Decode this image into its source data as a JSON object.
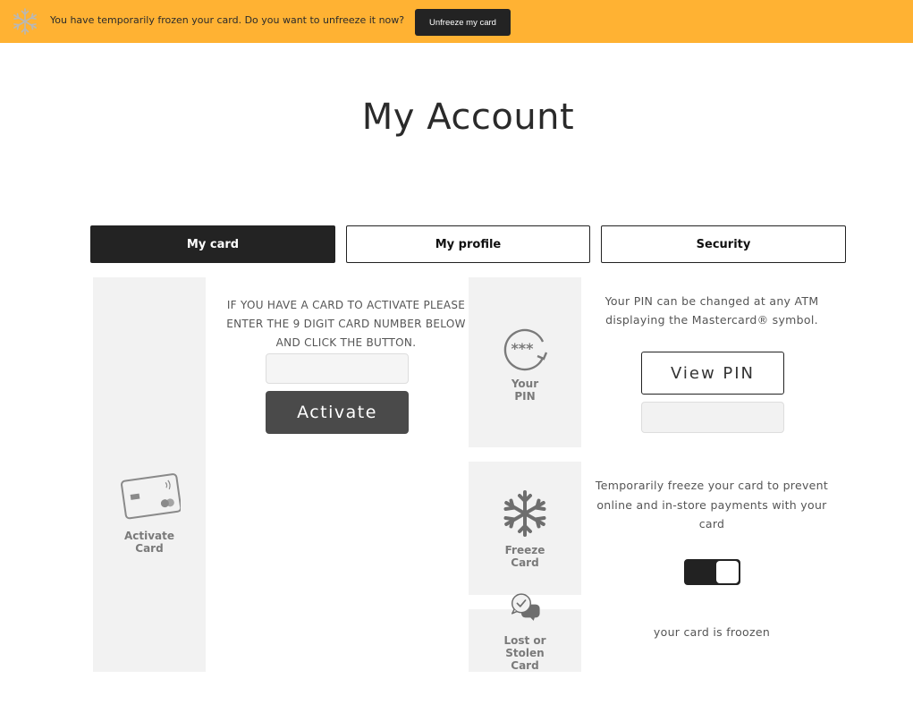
{
  "banner": {
    "icon": "snowflake-icon",
    "message": "You have temporarily frozen your card. Do you want to unfreeze it now?",
    "button_label": "Unfreeze my card",
    "background_color": "#ffb233"
  },
  "page": {
    "title": "My Account"
  },
  "tabs": [
    {
      "label": "My card",
      "active": true
    },
    {
      "label": "My profile",
      "active": false
    },
    {
      "label": "Security",
      "active": false
    }
  ],
  "activate": {
    "tile_icon": "credit-card-icon",
    "tile_label": "Activate\nCard",
    "instructions": "IF YOU HAVE A CARD TO ACTIVATE PLEASE ENTER THE 9 DIGIT CARD NUMBER BELOW AND CLICK THE BUTTON.",
    "input_value": "",
    "button_label": "Activate"
  },
  "pin": {
    "tile_icon": "pin-refresh-icon",
    "tile_label": "Your\nPIN",
    "description": "Your PIN can be changed at any ATM displaying the Mastercard® symbol.",
    "button_label": "View PIN",
    "display_value": ""
  },
  "freeze": {
    "tile_icon": "snowflake-icon",
    "tile_label": "Freeze\nCard",
    "description": "Temporarily freeze your card to prevent online and in-store payments with your card",
    "toggle_on": true,
    "status_text": "your card is froozen"
  },
  "lost": {
    "tile_icon": "chat-check-icon",
    "tile_label": "Lost or\nStolen\nCard"
  }
}
